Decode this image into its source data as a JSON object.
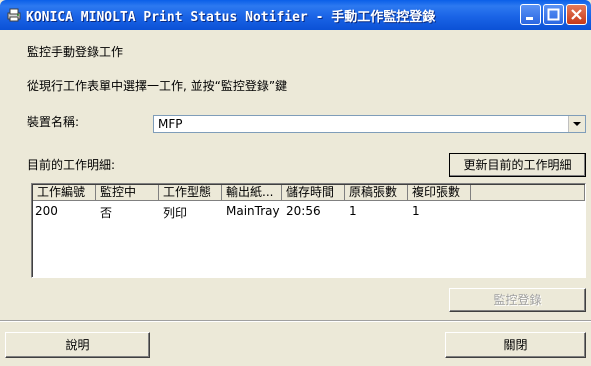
{
  "window": {
    "title": "KONICA MINOLTA Print Status Notifier - 手動工作監控登錄"
  },
  "section_title": "監控手動登錄工作",
  "instructions": "從現行工作表單中選擇一工作, 並按“監控登錄”鍵",
  "device": {
    "label": "裝置名稱:",
    "selected": "MFP"
  },
  "job_details": {
    "label": "目前的工作明細:",
    "refresh_label": "更新目前的工作明細"
  },
  "table": {
    "columns": [
      "工作編號",
      "監控中",
      "工作型態",
      "輸出紙...",
      "儲存時間",
      "原稿張數",
      "複印張數"
    ],
    "rows": [
      [
        "200",
        "否",
        "列印",
        "MainTray",
        "20:56",
        "1",
        "1"
      ]
    ]
  },
  "register_label": "監控登錄",
  "help_label": "說明",
  "close_label": "關閉"
}
